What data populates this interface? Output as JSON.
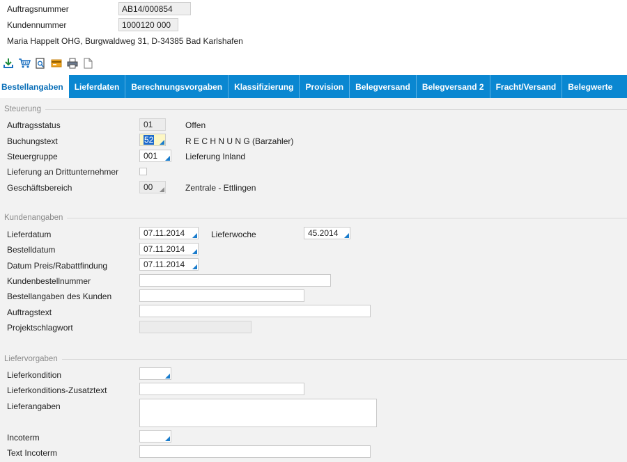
{
  "header": {
    "auftragsnummer_label": "Auftragsnummer",
    "auftragsnummer_value": "AB14/000854",
    "kundennummer_label": "Kundennummer",
    "kundennummer_value": "1000120 000",
    "address": "Maria Happelt OHG, Burgwaldweg 31, D-34385 Bad Karlshafen"
  },
  "toolbar": {
    "icons": [
      "download-icon",
      "cart-icon",
      "print-preview-icon",
      "card-icon",
      "printer-icon",
      "document-icon"
    ]
  },
  "tabs": [
    {
      "label": "Bestellangaben",
      "active": true
    },
    {
      "label": "Lieferdaten"
    },
    {
      "label": "Berechnungsvorgaben"
    },
    {
      "label": "Klassifizierung"
    },
    {
      "label": "Provision"
    },
    {
      "label": "Belegversand"
    },
    {
      "label": "Belegversand 2"
    },
    {
      "label": "Fracht/Versand"
    },
    {
      "label": "Belegwerte"
    }
  ],
  "steuerung": {
    "title": "Steuerung",
    "auftragsstatus": {
      "label": "Auftragsstatus",
      "value": "01",
      "desc": "Offen"
    },
    "buchungstext": {
      "label": "Buchungstext",
      "value": "52",
      "desc": "R E C H N U N G  (Barzahler)"
    },
    "steuergruppe": {
      "label": "Steuergruppe",
      "value": "001",
      "desc": "Lieferung Inland"
    },
    "lieferung_dritt": {
      "label": "Lieferung an Drittunternehmer",
      "checked": false
    },
    "geschaeftsbereich": {
      "label": "Geschäftsbereich",
      "value": "00",
      "desc": "Zentrale - Ettlingen"
    }
  },
  "kundenangaben": {
    "title": "Kundenangaben",
    "lieferdatum": {
      "label": "Lieferdatum",
      "value": "07.11.2014"
    },
    "lieferwoche": {
      "label": "Lieferwoche",
      "value": "45.2014"
    },
    "bestelldatum": {
      "label": "Bestelldatum",
      "value": "07.11.2014"
    },
    "datum_preis": {
      "label": "Datum Preis/Rabattfindung",
      "value": "07.11.2014"
    },
    "kundenbestellnummer": {
      "label": "Kundenbestellnummer",
      "value": ""
    },
    "bestellangaben": {
      "label": "Bestellangaben des Kunden",
      "value": ""
    },
    "auftragstext": {
      "label": "Auftragstext",
      "value": ""
    },
    "projektschlagwort": {
      "label": "Projektschlagwort",
      "value": ""
    }
  },
  "liefervorgaben": {
    "title": "Liefervorgaben",
    "lieferkondition": {
      "label": "Lieferkondition",
      "value": ""
    },
    "lieferkond_zusatz": {
      "label": "Lieferkonditions-Zusatztext",
      "value": ""
    },
    "lieferangaben": {
      "label": "Lieferangaben",
      "value": ""
    },
    "incoterm": {
      "label": "Incoterm",
      "value": ""
    },
    "text_incoterm": {
      "label": "Text Incoterm",
      "value": ""
    }
  },
  "colors": {
    "tab_bar": "#0a87d1",
    "active_tab_text": "#0a6fb8",
    "f4_marker": "#1a7ccc",
    "focus_field": "#fdf7c4"
  }
}
